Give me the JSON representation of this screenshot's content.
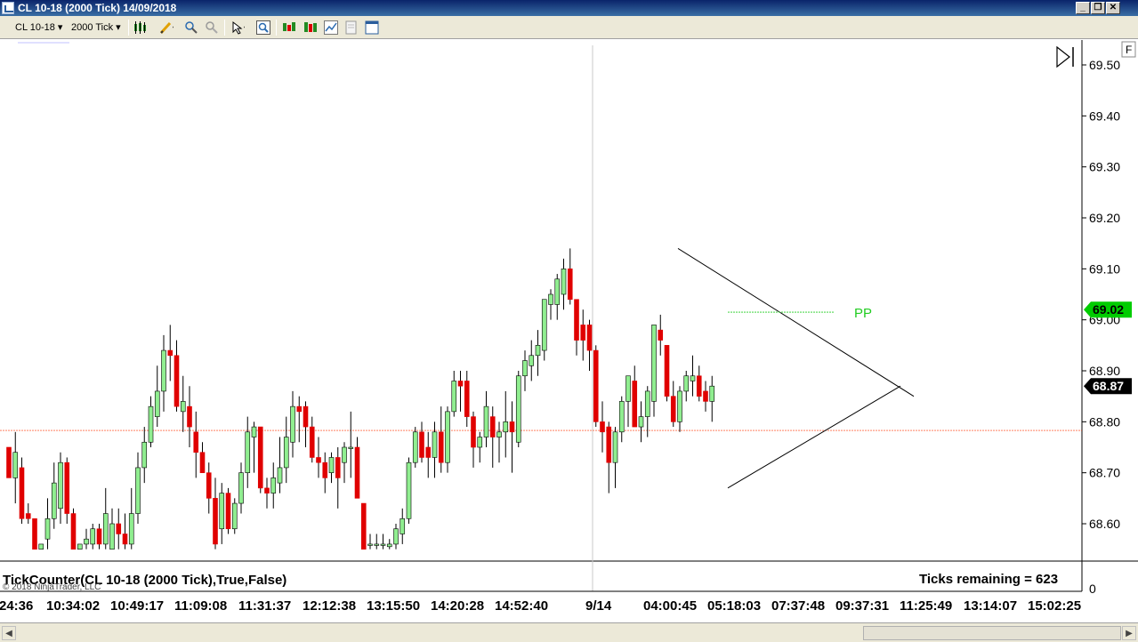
{
  "window": {
    "title": "CL 10-18 (2000 Tick)  14/09/2018",
    "buttons": [
      "minimize",
      "restore",
      "close"
    ]
  },
  "toolbar": {
    "instrument": "CL 10-18",
    "interval": "2000 Tick",
    "icons": [
      "bars-type-icon",
      "drawing-pencil-icon",
      "zoom-in-icon",
      "zoom-out-icon",
      "cursor-icon",
      "magnifier-icon",
      "indicators-icon",
      "strategies-icon",
      "chart-style-icon",
      "properties-icon",
      "data-box-icon"
    ]
  },
  "chart": {
    "panel_toggle_label": "F",
    "triangle_label": "PP",
    "price_axis_ticks": [
      "69.50",
      "69.40",
      "69.30",
      "69.20",
      "69.10",
      "69.00",
      "68.90",
      "68.80",
      "68.70",
      "68.60"
    ],
    "last_price": "68.87",
    "marker_price": "69.02",
    "indicator_title": "TickCounter(CL 10-18 (2000 Tick),True,False)",
    "indicator_status": "Ticks remaining = 623",
    "indicator_axis_zero": "0",
    "copyright": "© 2018 NinjaTrader, LLC",
    "time_labels": [
      "24:36",
      "10:34:02",
      "10:49:17",
      "11:09:08",
      "11:31:37",
      "12:12:38",
      "13:15:50",
      "14:20:28",
      "14:52:40",
      "9/14",
      "04:00:45",
      "05:18:03",
      "07:37:48",
      "09:37:31",
      "11:25:49",
      "13:14:07",
      "15:02:25"
    ],
    "colors": {
      "up_candle": "#90ee90",
      "down_candle": "#e00000",
      "wick": "#000000",
      "last_price_bg": "#000000",
      "marker_bg": "#00cc00",
      "pp_color": "#22cc22",
      "hline": "#ff3300"
    }
  },
  "chart_data": {
    "type": "candlestick",
    "price_range": [
      68.555,
      69.52
    ],
    "candles": [
      {
        "o": 68.75,
        "h": 68.75,
        "l": 68.7,
        "c": 68.69
      },
      {
        "o": 68.69,
        "h": 68.78,
        "l": 68.64,
        "c": 68.74
      },
      {
        "o": 68.71,
        "h": 68.73,
        "l": 68.6,
        "c": 68.61
      },
      {
        "o": 68.62,
        "h": 68.64,
        "l": 68.6,
        "c": 68.61
      },
      {
        "o": 68.61,
        "h": 68.61,
        "l": 68.55,
        "c": 68.55
      },
      {
        "o": 68.55,
        "h": 68.56,
        "l": 68.55,
        "c": 68.56
      },
      {
        "o": 68.57,
        "h": 68.65,
        "l": 68.55,
        "c": 68.61
      },
      {
        "o": 68.61,
        "h": 68.72,
        "l": 68.59,
        "c": 68.68
      },
      {
        "o": 68.63,
        "h": 68.74,
        "l": 68.6,
        "c": 68.72
      },
      {
        "o": 68.72,
        "h": 68.73,
        "l": 68.6,
        "c": 68.62
      },
      {
        "o": 68.62,
        "h": 68.63,
        "l": 68.55,
        "c": 68.55
      },
      {
        "o": 68.55,
        "h": 68.56,
        "l": 68.55,
        "c": 68.56
      },
      {
        "o": 68.56,
        "h": 68.59,
        "l": 68.55,
        "c": 68.57
      },
      {
        "o": 68.56,
        "h": 68.6,
        "l": 68.55,
        "c": 68.59
      },
      {
        "o": 68.59,
        "h": 68.6,
        "l": 68.55,
        "c": 68.56
      },
      {
        "o": 68.56,
        "h": 68.67,
        "l": 68.55,
        "c": 68.62
      },
      {
        "o": 68.55,
        "h": 68.63,
        "l": 68.55,
        "c": 68.6
      },
      {
        "o": 68.6,
        "h": 68.63,
        "l": 68.55,
        "c": 68.58
      },
      {
        "o": 68.58,
        "h": 68.62,
        "l": 68.55,
        "c": 68.56
      },
      {
        "o": 68.56,
        "h": 68.67,
        "l": 68.55,
        "c": 68.62
      },
      {
        "o": 68.62,
        "h": 68.74,
        "l": 68.6,
        "c": 68.71
      },
      {
        "o": 68.71,
        "h": 68.79,
        "l": 68.68,
        "c": 68.76
      },
      {
        "o": 68.76,
        "h": 68.85,
        "l": 68.75,
        "c": 68.83
      },
      {
        "o": 68.81,
        "h": 68.91,
        "l": 68.79,
        "c": 68.86
      },
      {
        "o": 68.86,
        "h": 68.97,
        "l": 68.82,
        "c": 68.94
      },
      {
        "o": 68.94,
        "h": 68.99,
        "l": 68.88,
        "c": 68.93
      },
      {
        "o": 68.93,
        "h": 68.96,
        "l": 68.82,
        "c": 68.83
      },
      {
        "o": 68.82,
        "h": 68.89,
        "l": 68.78,
        "c": 68.84
      },
      {
        "o": 68.83,
        "h": 68.87,
        "l": 68.75,
        "c": 68.79
      },
      {
        "o": 68.78,
        "h": 68.82,
        "l": 68.69,
        "c": 68.74
      },
      {
        "o": 68.74,
        "h": 68.76,
        "l": 68.7,
        "c": 68.7
      },
      {
        "o": 68.7,
        "h": 68.72,
        "l": 68.62,
        "c": 68.65
      },
      {
        "o": 68.65,
        "h": 68.69,
        "l": 68.55,
        "c": 68.56
      },
      {
        "o": 68.59,
        "h": 68.68,
        "l": 68.56,
        "c": 68.66
      },
      {
        "o": 68.66,
        "h": 68.67,
        "l": 68.58,
        "c": 68.59
      },
      {
        "o": 68.59,
        "h": 68.65,
        "l": 68.58,
        "c": 68.64
      },
      {
        "o": 68.64,
        "h": 68.72,
        "l": 68.62,
        "c": 68.7
      },
      {
        "o": 68.7,
        "h": 68.81,
        "l": 68.67,
        "c": 68.78
      },
      {
        "o": 68.77,
        "h": 68.8,
        "l": 68.7,
        "c": 68.79
      },
      {
        "o": 68.79,
        "h": 68.79,
        "l": 68.66,
        "c": 68.67
      },
      {
        "o": 68.67,
        "h": 68.69,
        "l": 68.63,
        "c": 68.66
      },
      {
        "o": 68.66,
        "h": 68.72,
        "l": 68.63,
        "c": 68.69
      },
      {
        "o": 68.68,
        "h": 68.77,
        "l": 68.66,
        "c": 68.71
      },
      {
        "o": 68.71,
        "h": 68.81,
        "l": 68.68,
        "c": 68.77
      },
      {
        "o": 68.76,
        "h": 68.86,
        "l": 68.73,
        "c": 68.83
      },
      {
        "o": 68.83,
        "h": 68.85,
        "l": 68.76,
        "c": 68.82
      },
      {
        "o": 68.83,
        "h": 68.84,
        "l": 68.75,
        "c": 68.79
      },
      {
        "o": 68.79,
        "h": 68.81,
        "l": 68.72,
        "c": 68.73
      },
      {
        "o": 68.73,
        "h": 68.77,
        "l": 68.69,
        "c": 68.72
      },
      {
        "o": 68.72,
        "h": 68.74,
        "l": 68.66,
        "c": 68.69
      },
      {
        "o": 68.7,
        "h": 68.74,
        "l": 68.68,
        "c": 68.73
      },
      {
        "o": 68.73,
        "h": 68.75,
        "l": 68.63,
        "c": 68.69
      },
      {
        "o": 68.72,
        "h": 68.76,
        "l": 68.68,
        "c": 68.75
      },
      {
        "o": 68.75,
        "h": 68.82,
        "l": 68.69,
        "c": 68.75
      },
      {
        "o": 68.75,
        "h": 68.77,
        "l": 68.65,
        "c": 68.65
      },
      {
        "o": 68.64,
        "h": 68.64,
        "l": 68.55,
        "c": 68.55
      },
      {
        "o": 68.56,
        "h": 68.58,
        "l": 68.55,
        "c": 68.56
      },
      {
        "o": 68.56,
        "h": 68.58,
        "l": 68.55,
        "c": 68.56
      },
      {
        "o": 68.56,
        "h": 68.58,
        "l": 68.55,
        "c": 68.56
      },
      {
        "o": 68.555,
        "h": 68.57,
        "l": 68.55,
        "c": 68.56
      },
      {
        "o": 68.56,
        "h": 68.6,
        "l": 68.55,
        "c": 68.59
      },
      {
        "o": 68.58,
        "h": 68.63,
        "l": 68.56,
        "c": 68.61
      },
      {
        "o": 68.61,
        "h": 68.73,
        "l": 68.6,
        "c": 68.72
      },
      {
        "o": 68.72,
        "h": 68.79,
        "l": 68.71,
        "c": 68.78
      },
      {
        "o": 68.78,
        "h": 68.8,
        "l": 68.72,
        "c": 68.73
      },
      {
        "o": 68.75,
        "h": 68.78,
        "l": 68.69,
        "c": 68.73
      },
      {
        "o": 68.73,
        "h": 68.8,
        "l": 68.69,
        "c": 68.78
      },
      {
        "o": 68.78,
        "h": 68.83,
        "l": 68.7,
        "c": 68.72
      },
      {
        "o": 68.72,
        "h": 68.83,
        "l": 68.7,
        "c": 68.82
      },
      {
        "o": 68.82,
        "h": 68.9,
        "l": 68.81,
        "c": 68.88
      },
      {
        "o": 68.88,
        "h": 68.9,
        "l": 68.82,
        "c": 68.87
      },
      {
        "o": 68.88,
        "h": 68.9,
        "l": 68.79,
        "c": 68.81
      },
      {
        "o": 68.81,
        "h": 68.82,
        "l": 68.71,
        "c": 68.75
      },
      {
        "o": 68.75,
        "h": 68.78,
        "l": 68.72,
        "c": 68.77
      },
      {
        "o": 68.77,
        "h": 68.86,
        "l": 68.75,
        "c": 68.83
      },
      {
        "o": 68.81,
        "h": 68.83,
        "l": 68.71,
        "c": 68.77
      },
      {
        "o": 68.77,
        "h": 68.8,
        "l": 68.72,
        "c": 68.78
      },
      {
        "o": 68.78,
        "h": 68.86,
        "l": 68.73,
        "c": 68.8
      },
      {
        "o": 68.8,
        "h": 68.84,
        "l": 68.7,
        "c": 68.78
      },
      {
        "o": 68.76,
        "h": 68.9,
        "l": 68.75,
        "c": 68.89
      },
      {
        "o": 68.89,
        "h": 68.94,
        "l": 68.86,
        "c": 68.92
      },
      {
        "o": 68.91,
        "h": 68.96,
        "l": 68.88,
        "c": 68.93
      },
      {
        "o": 68.93,
        "h": 68.98,
        "l": 68.89,
        "c": 68.95
      },
      {
        "o": 68.94,
        "h": 69.03,
        "l": 68.92,
        "c": 69.04
      },
      {
        "o": 69.03,
        "h": 69.06,
        "l": 69.0,
        "c": 69.05
      },
      {
        "o": 69.03,
        "h": 69.09,
        "l": 69.0,
        "c": 69.08
      },
      {
        "o": 69.05,
        "h": 69.12,
        "l": 69.02,
        "c": 69.1
      },
      {
        "o": 69.1,
        "h": 69.14,
        "l": 69.03,
        "c": 69.04
      },
      {
        "o": 69.04,
        "h": 69.04,
        "l": 68.93,
        "c": 68.96
      },
      {
        "o": 68.99,
        "h": 69.02,
        "l": 68.92,
        "c": 68.96
      },
      {
        "o": 68.99,
        "h": 69.0,
        "l": 68.9,
        "c": 68.94
      },
      {
        "o": 68.94,
        "h": 68.95,
        "l": 68.79,
        "c": 68.8
      },
      {
        "o": 68.8,
        "h": 68.84,
        "l": 68.74,
        "c": 68.78
      },
      {
        "o": 68.79,
        "h": 68.8,
        "l": 68.66,
        "c": 68.72
      },
      {
        "o": 68.72,
        "h": 68.79,
        "l": 68.67,
        "c": 68.78
      },
      {
        "o": 68.78,
        "h": 68.85,
        "l": 68.76,
        "c": 68.84
      },
      {
        "o": 68.84,
        "h": 68.89,
        "l": 68.79,
        "c": 68.89
      },
      {
        "o": 68.88,
        "h": 68.91,
        "l": 68.79,
        "c": 68.79
      },
      {
        "o": 68.79,
        "h": 68.84,
        "l": 68.76,
        "c": 68.81
      },
      {
        "o": 68.81,
        "h": 68.87,
        "l": 68.77,
        "c": 68.86
      },
      {
        "o": 68.84,
        "h": 68.98,
        "l": 68.81,
        "c": 68.99
      },
      {
        "o": 68.98,
        "h": 69.01,
        "l": 68.93,
        "c": 68.96
      },
      {
        "o": 68.95,
        "h": 68.95,
        "l": 68.84,
        "c": 68.85
      },
      {
        "o": 68.85,
        "h": 68.88,
        "l": 68.79,
        "c": 68.8
      },
      {
        "o": 68.8,
        "h": 68.87,
        "l": 68.78,
        "c": 68.86
      },
      {
        "o": 68.86,
        "h": 68.9,
        "l": 68.84,
        "c": 68.89
      },
      {
        "o": 68.88,
        "h": 68.93,
        "l": 68.85,
        "c": 68.89
      },
      {
        "o": 68.89,
        "h": 68.91,
        "l": 68.84,
        "c": 68.85
      },
      {
        "o": 68.86,
        "h": 68.88,
        "l": 68.82,
        "c": 68.84
      },
      {
        "o": 68.84,
        "h": 68.89,
        "l": 68.8,
        "c": 68.87
      }
    ],
    "reference_price": 68.783,
    "triangle": {
      "upper": [
        [
          68.85,
          69.14
        ],
        [
          68.85,
          68.85
        ]
      ],
      "lower": [
        [
          68.67,
          68.87
        ]
      ],
      "pp_price": 69.015
    }
  }
}
